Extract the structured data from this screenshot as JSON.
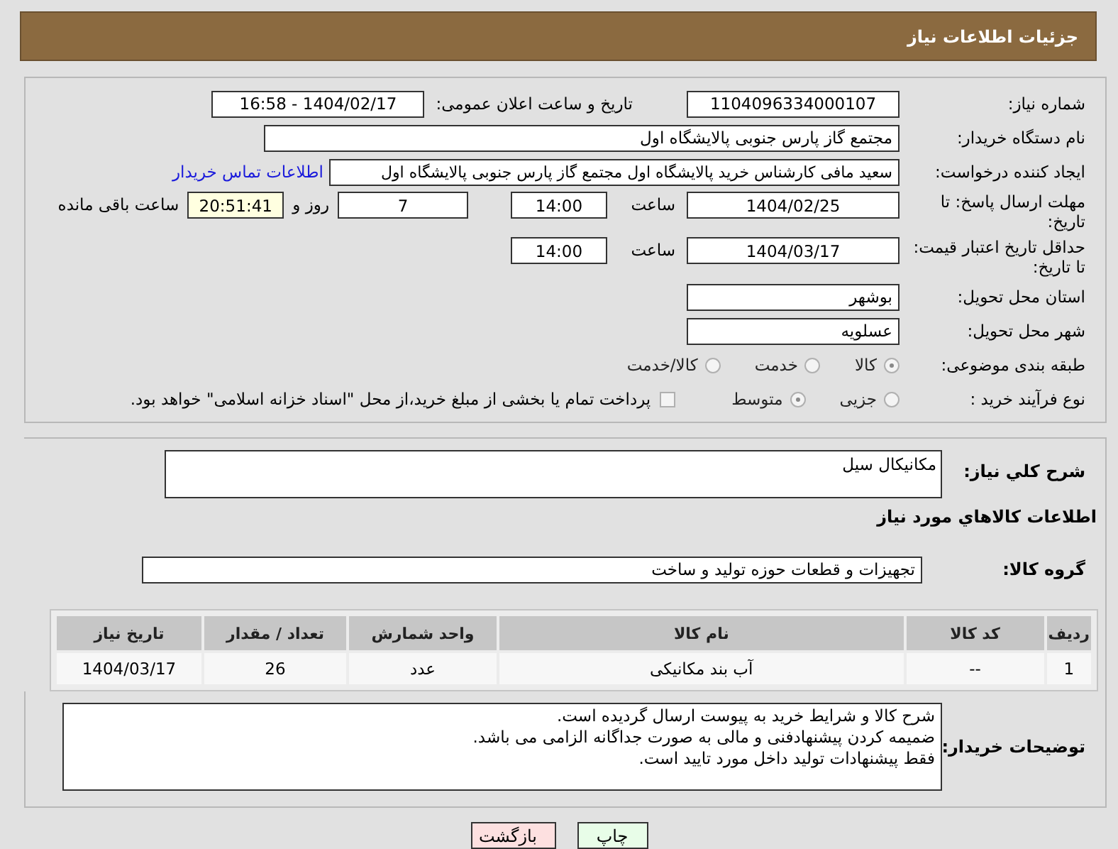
{
  "header": {
    "title": "جزئیات اطلاعات نیاز"
  },
  "details": {
    "need_number": {
      "label": "شماره نیاز:",
      "value": "1104096334000107"
    },
    "announce": {
      "label": "تاریخ و ساعت اعلان عمومی:",
      "value": "1404/02/17 - 16:58"
    },
    "buyer": {
      "label": "نام دستگاه خریدار:",
      "value": "مجتمع گاز پارس جنوبی  پالایشگاه اول"
    },
    "requester": {
      "label": "ایجاد کننده درخواست:",
      "value": "سعید مافی کارشناس خرید پالایشگاه اول مجتمع گاز پارس جنوبی  پالایشگاه اول",
      "link": "اطلاعات تماس خریدار"
    },
    "reply_deadline": {
      "label": "مهلت ارسال پاسخ: تا تاریخ:",
      "date": "1404/02/25",
      "time_label": "ساعت",
      "time": "14:00",
      "days": "7",
      "days_label": "روز و",
      "remaining": "20:51:41",
      "remaining_label": "ساعت باقی مانده"
    },
    "validity": {
      "label": "حداقل تاریخ اعتبار قیمت: تا تاریخ:",
      "date": "1404/03/17",
      "time_label": "ساعت",
      "time": "14:00"
    },
    "province": {
      "label": "استان محل تحویل:",
      "value": "بوشهر"
    },
    "city": {
      "label": "شهر محل تحویل:",
      "value": "عسلویه"
    },
    "category": {
      "label": "طبقه بندی موضوعی:",
      "options": [
        {
          "label": "کالا",
          "selected": true
        },
        {
          "label": "خدمت",
          "selected": false
        },
        {
          "label": "کالا/خدمت",
          "selected": false
        }
      ]
    },
    "process": {
      "label": "نوع فرآیند خرید :",
      "options": [
        {
          "label": "جزیی",
          "selected": false
        },
        {
          "label": "متوسط",
          "selected": true
        }
      ],
      "note": {
        "label": "پرداخت تمام یا بخشی از مبلغ خرید،از محل \"اسناد خزانه اسلامی\" خواهد بود.",
        "checked": false
      }
    }
  },
  "description": {
    "label": "شرح کلي نياز:",
    "value": "مکانیکال سیل"
  },
  "goods_title": "اطلاعات کالاهاي مورد نياز",
  "goods_group": {
    "label": "گروه کالا:",
    "value": "تجهیزات و قطعات حوزه تولید و ساخت"
  },
  "table": {
    "columns": [
      "ردیف",
      "کد کالا",
      "نام کالا",
      "واحد شمارش",
      "تعداد / مقدار",
      "تاریخ نیاز"
    ],
    "rows": [
      [
        "1",
        "--",
        "آب بند مکانیکی",
        "عدد",
        "26",
        "1404/03/17"
      ]
    ]
  },
  "buyer_notes": {
    "label": "توضیحات خریدار:",
    "lines": [
      "شرح کالا و شرایط خرید به پیوست ارسال گردیده است.",
      "ضمیمه کردن پیشنهادفنی و مالی به صورت جداگانه الزامی می باشد.",
      "فقط پیشنهادات تولید داخل مورد تایید است."
    ]
  },
  "buttons": [
    {
      "label": "چاپ",
      "kind": "print"
    },
    {
      "label": "بازگشت",
      "kind": "back"
    }
  ]
}
